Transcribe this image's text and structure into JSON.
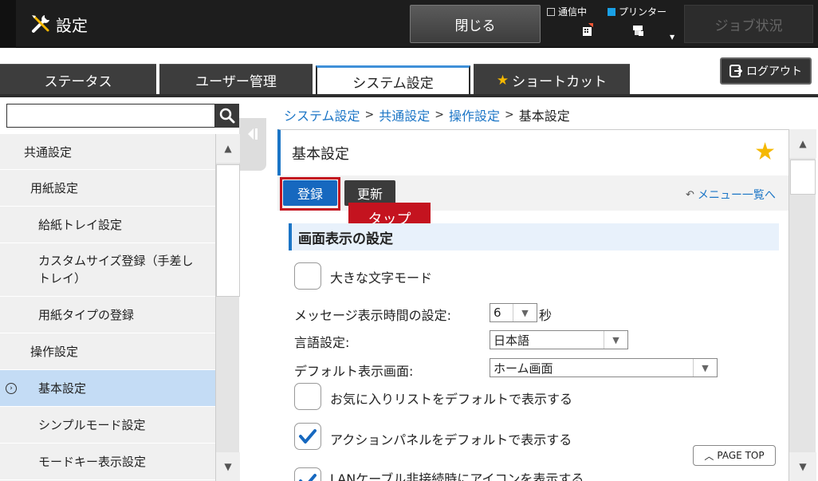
{
  "header": {
    "title": "設定",
    "close_label": "閉じる",
    "status": {
      "comm_label": "通信中",
      "printer_label": "プリンター"
    },
    "job_status_label": "ジョブ状況",
    "logout_label": "ログアウト"
  },
  "tabs": [
    {
      "label": "ステータス"
    },
    {
      "label": "ユーザー管理"
    },
    {
      "label": "システム設定"
    },
    {
      "label": "ショートカット"
    }
  ],
  "sidebar": {
    "search_value": "",
    "items": [
      {
        "label": "共通設定"
      },
      {
        "label": "用紙設定"
      },
      {
        "label": "給紙トレイ設定"
      },
      {
        "label": "カスタムサイズ登録（手差しトレイ）"
      },
      {
        "label": "用紙タイプの登録"
      },
      {
        "label": "操作設定"
      },
      {
        "label": "基本設定"
      },
      {
        "label": "シンプルモード設定"
      },
      {
        "label": "モードキー表示設定"
      }
    ]
  },
  "breadcrumb": {
    "c1": "システム設定",
    "c2": "共通設定",
    "c3": "操作設定",
    "current": "基本設定",
    "sep": ">"
  },
  "main": {
    "title": "基本設定",
    "register_label": "登録",
    "update_label": "更新",
    "menu_list_label": "メニュー一覧へ",
    "tap_label": "タップ",
    "section_title": "画面表示の設定",
    "large_text_label": "大きな文字モード",
    "message_time_label": "メッセージ表示時間の設定:",
    "message_time_value": "6",
    "message_time_unit": "秒",
    "language_label": "言語設定:",
    "language_value": "日本語",
    "default_screen_label": "デフォルト表示画面:",
    "default_screen_value": "ホーム画面",
    "favorites_label": "お気に入りリストをデフォルトで表示する",
    "action_panel_label": "アクションパネルをデフォルトで表示する",
    "lan_label": "LANケーブル非接続時にアイコンを表示する",
    "page_top_label": "PAGE TOP"
  },
  "colors": {
    "accent": "#1b75c6",
    "highlight": "#c4131f",
    "star": "#f5b800",
    "selected": "#c4dcf5"
  }
}
